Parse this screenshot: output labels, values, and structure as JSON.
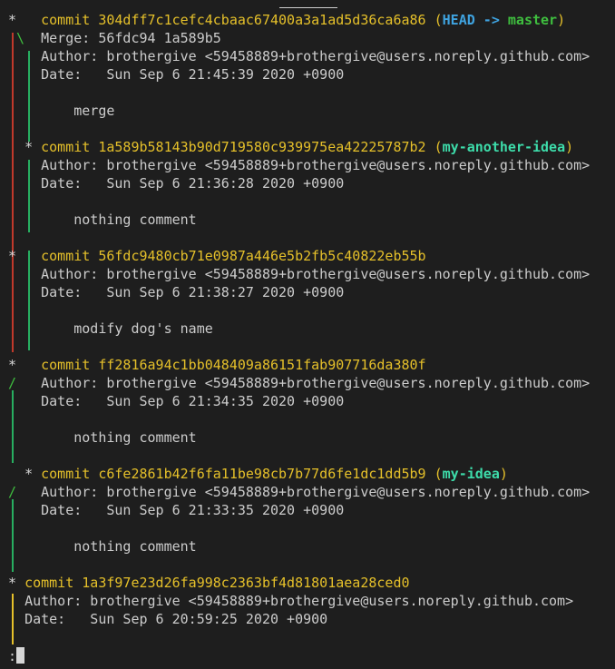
{
  "commits": [
    {
      "star": "*",
      "label": "commit",
      "hash": "304dff7c1cefc4cbaac67400a3a1ad5d36ca6a86",
      "ref_open": "(",
      "ref_head": "HEAD",
      "ref_arrow": "->",
      "ref_branch": "master",
      "ref_close": ")",
      "merge": "Merge: 56fdc94 1a589b5",
      "author": "Author: brothergive <59458889+brothergive@users.noreply.github.com>",
      "date": "Date:   Sun Sep 6 21:45:39 2020 +0900",
      "message": "merge"
    },
    {
      "star": "*",
      "label": "commit",
      "hash": "1a589b58143b90d719580c939975ea42225787b2",
      "ref_open": "(",
      "ref_branch": "my-another-idea",
      "ref_close": ")",
      "author": "Author: brothergive <59458889+brothergive@users.noreply.github.com>",
      "date": "Date:   Sun Sep 6 21:36:28 2020 +0900",
      "message": "nothing comment"
    },
    {
      "star": "*",
      "label": "commit",
      "hash": "56fdc9480cb71e0987a446e5b2fb5c40822eb55b",
      "author": "Author: brothergive <59458889+brothergive@users.noreply.github.com>",
      "date": "Date:   Sun Sep 6 21:38:27 2020 +0900",
      "message": "modify dog's name"
    },
    {
      "star": "*",
      "label": "commit",
      "hash": "ff2816a94c1bb048409a86151fab907716da380f",
      "author": "Author: brothergive <59458889+brothergive@users.noreply.github.com>",
      "date": "Date:   Sun Sep 6 21:34:35 2020 +0900",
      "message": "nothing comment"
    },
    {
      "star": "*",
      "label": "commit",
      "hash": "c6fe2861b42f6fa11be98cb7b77d6fe1dc1dd5b9",
      "ref_open": "(",
      "ref_branch": "my-idea",
      "ref_close": ")",
      "author": "Author: brothergive <59458889+brothergive@users.noreply.github.com>",
      "date": "Date:   Sun Sep 6 21:33:35 2020 +0900",
      "message": "nothing comment"
    },
    {
      "star": "*",
      "label": "commit",
      "hash": "1a3f97e23d26fa998c2363bf4d81801aea28ced0",
      "author": "Author: brothergive <59458889+brothergive@users.noreply.github.com>",
      "date": "Date:   Sun Sep 6 20:59:25 2020 +0900"
    }
  ],
  "graph": {
    "merge_glyph": "\\",
    "join_glyph": "/",
    "star_glyph": "*"
  },
  "prompt": ":",
  "colors": {
    "background": "#1e1e1e",
    "text": "#cccccc",
    "hash": "#e5c02a",
    "head": "#3fa3e0",
    "branch_master": "#3fbf3f",
    "branch_other": "#3ddcaa",
    "rail_red": "#c0392b",
    "rail_green": "#27ae60",
    "rail_yellow": "#e5c02a"
  }
}
